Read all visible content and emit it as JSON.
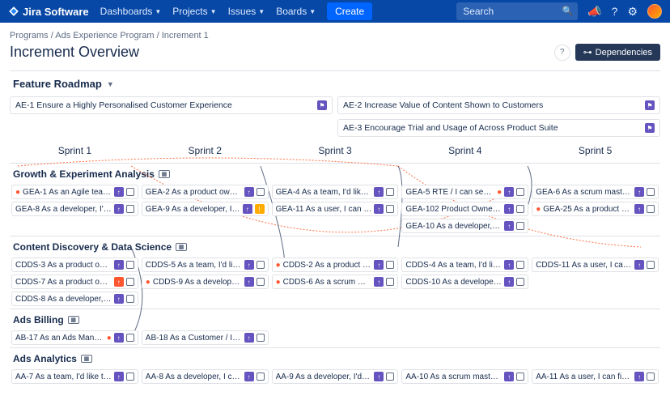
{
  "topbar": {
    "product": "Jira Software",
    "nav": [
      "Dashboards",
      "Projects",
      "Issues",
      "Boards"
    ],
    "create": "Create",
    "search_placeholder": "Search"
  },
  "crumbs": {
    "p1": "Programs",
    "p2": "Ads Experience Program",
    "p3": "Increment 1"
  },
  "title": "Increment Overview",
  "dependencies": "Dependencies",
  "feature_roadmap": "Feature Roadmap",
  "features": {
    "f1": "AE-1 Ensure a Highly Personalised Customer Experience",
    "f2": "AE-2 Increase Value of Content Shown to Customers",
    "f3": "AE-3 Encourage Trial and Usage of Across Product Suite"
  },
  "sprints": [
    "Sprint 1",
    "Sprint 2",
    "Sprint 3",
    "Sprint 4",
    "Sprint 5"
  ],
  "swimlanes": {
    "gea": {
      "name": "Growth & Experiment Analysis",
      "r1": {
        "c1": "GEA-1 As an Agile team, I'd like to…",
        "c2": "GEA-2 As a product owner, I'd lik…",
        "c3": "GEA-4 As a team, I'd like to estim…",
        "c4": "GEA-5 RTE / I can see dependenc…",
        "c5": "GEA-6 As a scrum master, I'd like …"
      },
      "r2": {
        "c1": "GEA-8 As a developer, I'd like to u…",
        "c2": "GEA-9 As a developer, I can upda…",
        "c3": "GEA-11 As a user, I can find impor…",
        "c4": "GEA-102 Product Owner / drag a…",
        "c5": "GEA-25 As a product owner I can …"
      },
      "r3": {
        "c4": "GEA-10 As a developer, I can upd…"
      }
    },
    "cdds": {
      "name": "Content Discovery & Data Science",
      "r1": {
        "c1": "CDDS-3 As a product owner, I'd li…",
        "c2": "CDDS-5 As a team, I'd like to com…",
        "c3": "CDDS-2 As a product owner, I'd li…",
        "c4": "CDDS-4 As a team, I'd like to esti…",
        "c5": "CDDS-11 As a user, I can find imp…"
      },
      "r2": {
        "c1": "CDDS-7 As a product owner, I'd li…",
        "c2": "CDDS-9 As a developer, I can up…",
        "c3": "CDDS-6 As a scrum master, I'd lik…",
        "c4": "CDDS-10 As a developer, I can up…"
      },
      "r3": {
        "c1": "CDDS-8 As a developer, I'd like to…"
      }
    },
    "ab": {
      "name": "Ads Billing",
      "r1": {
        "c1": "AB-17 As an Ads Manager / I only …",
        "c2": "AB-18 As a Customer / I want to v…"
      }
    },
    "aa": {
      "name": "Ads Analytics",
      "r1": {
        "c1": "AA-7 As a team, I'd like to commit…",
        "c2": "AA-8 As a developer, I can updat…",
        "c3": "AA-9 As a developer, I'd like to u…",
        "c4": "AA-10 As a scrum master, I'd like …",
        "c5": "AA-11 As a user, I can find import…"
      }
    }
  }
}
